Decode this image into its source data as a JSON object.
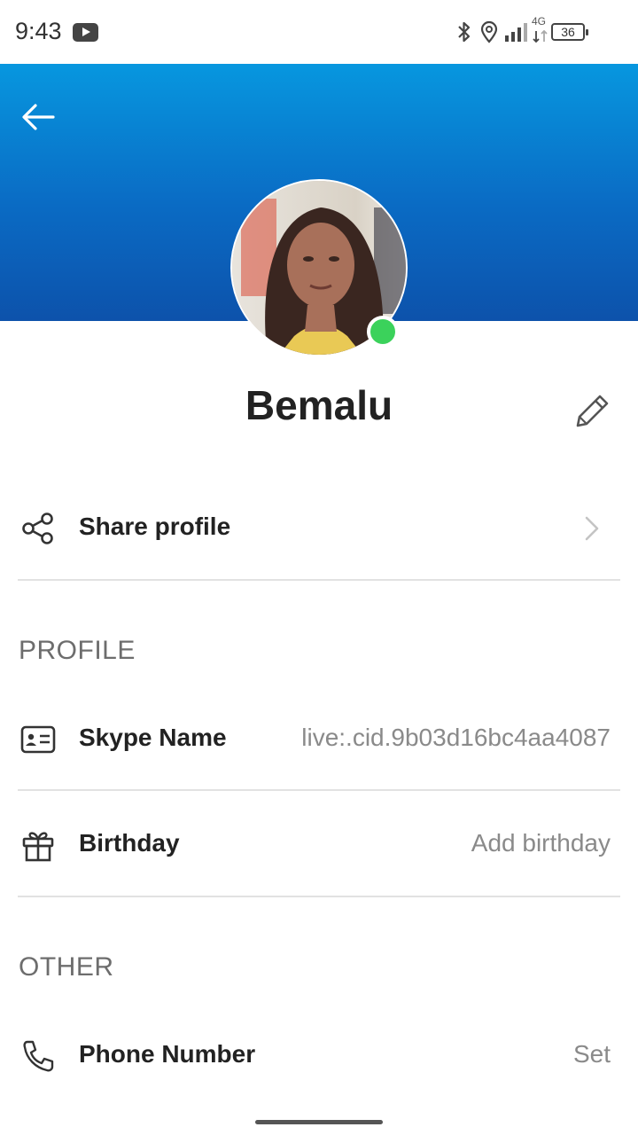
{
  "status_bar": {
    "time": "9:43",
    "network": "4G",
    "battery": "36"
  },
  "header": {
    "back_icon": "arrow-left-icon",
    "color_top": "#0797df",
    "color_bottom": "#0d52ab"
  },
  "profile": {
    "display_name": "Bemalu",
    "presence_color": "#3bd25b",
    "edit_icon": "pencil-icon"
  },
  "share": {
    "label": "Share profile",
    "icon": "share-icon"
  },
  "sections": {
    "profile_title": "PROFILE",
    "other_title": "OTHER"
  },
  "skype_name": {
    "label": "Skype Name",
    "value": "live:.cid.9b03d16bc4aa4087",
    "icon": "id-card-icon"
  },
  "birthday": {
    "label": "Birthday",
    "value": "Add birthday",
    "icon": "gift-icon"
  },
  "phone": {
    "label": "Phone Number",
    "value": "Set",
    "icon": "phone-icon"
  }
}
